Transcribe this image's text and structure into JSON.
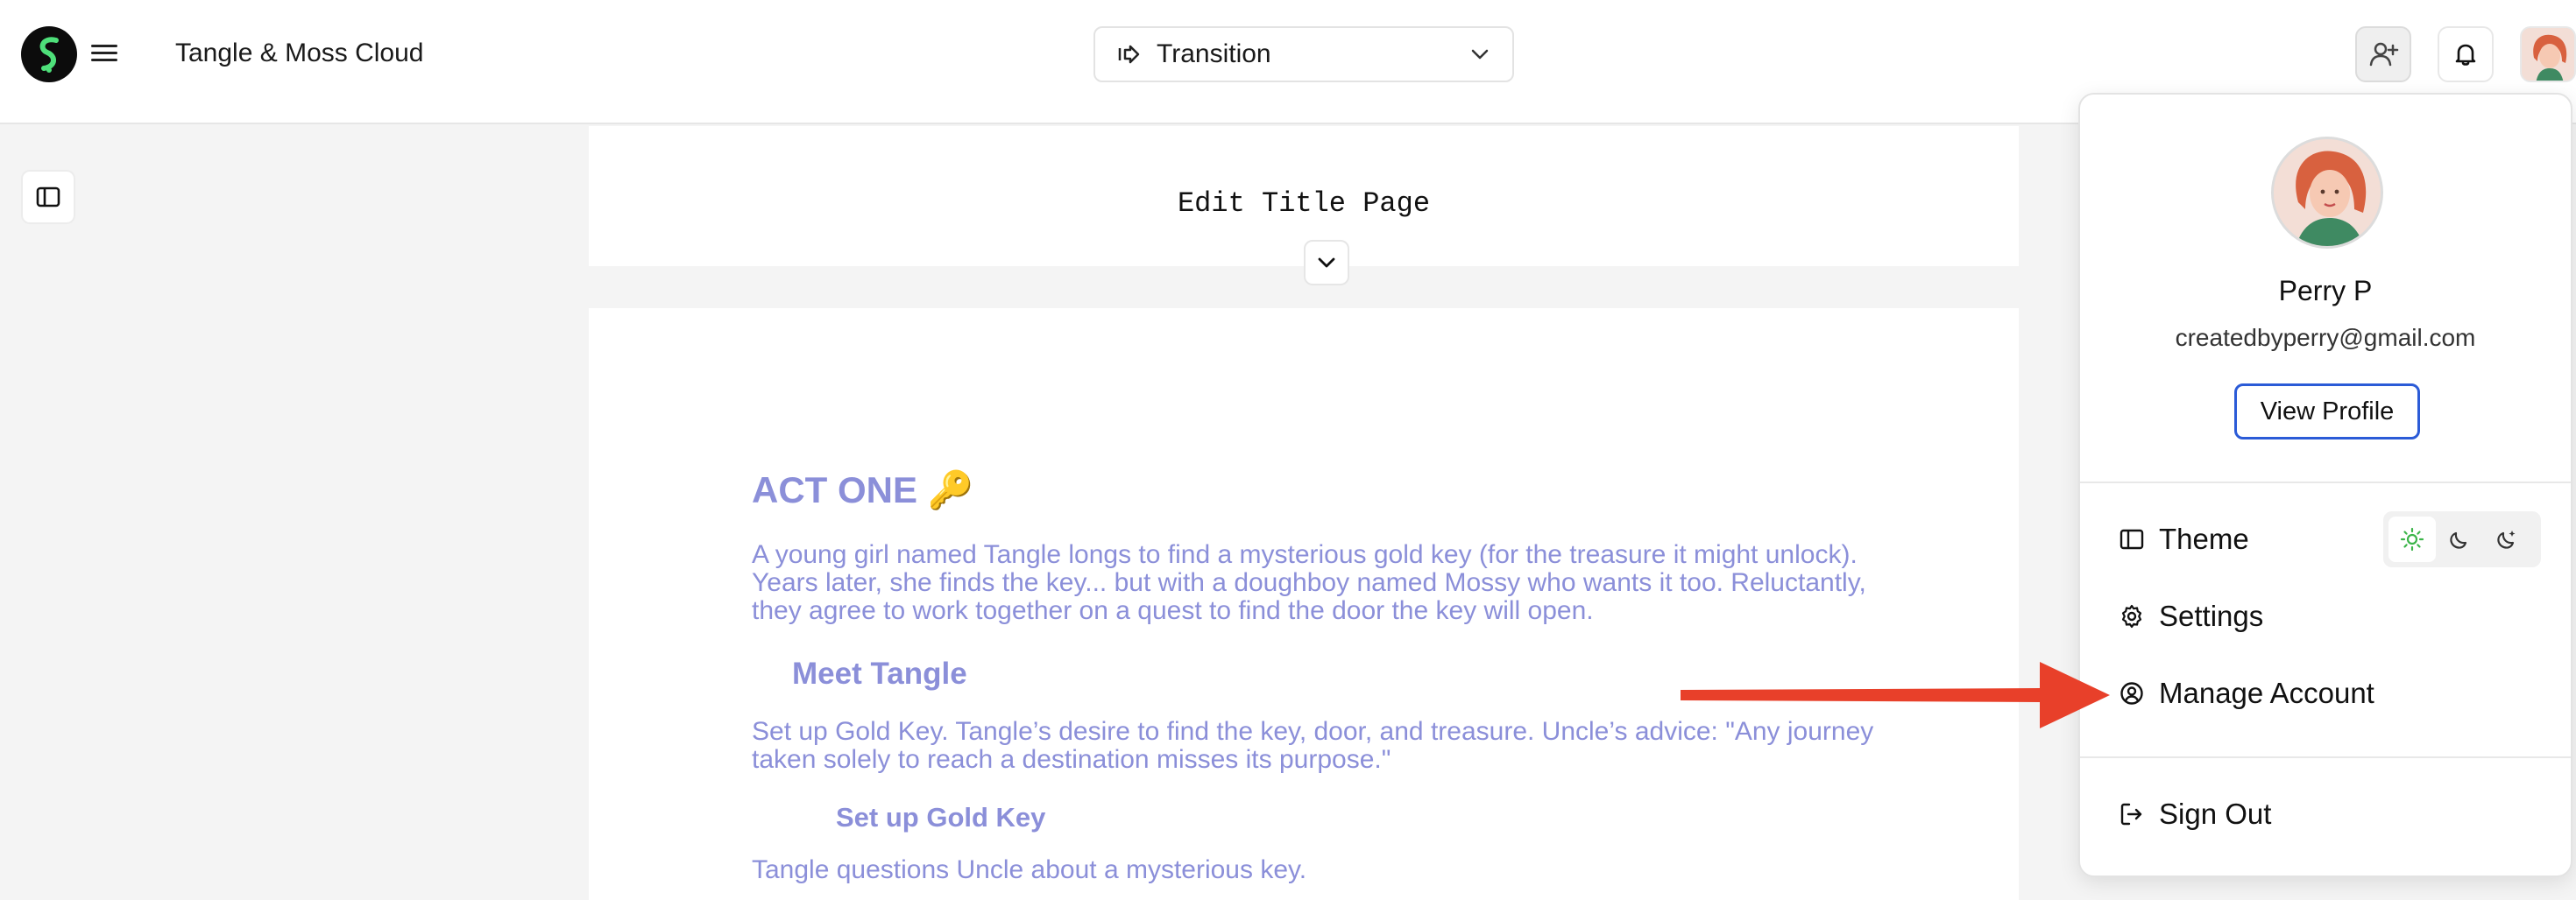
{
  "header": {
    "app_title": "Tangle & Moss Cloud",
    "element_selector": {
      "value": "Transition"
    }
  },
  "title_page": {
    "edit_label": "Edit Title Page"
  },
  "script": {
    "act": {
      "heading": "ACT ONE 🔑",
      "description": "A young girl named Tangle longs to find a mysterious gold key (for the treasure it might unlock). Years later, she finds the key... but with a doughboy named Mossy who wants it too. Reluctantly, they agree to work together on a quest to find the door the key will open."
    },
    "sequence": {
      "heading": "Meet Tangle",
      "description": "Set up Gold Key. Tangle’s desire to find the key, door, and treasure. Uncle’s advice: \"Any journey taken solely to reach a destination misses its purpose.\""
    },
    "scene": {
      "heading": "Set up Gold Key",
      "description": "Tangle questions Uncle about a mysterious key."
    }
  },
  "profile_menu": {
    "name": "Perry P",
    "email": "createdbyperry@gmail.com",
    "view_profile_label": "View Profile",
    "theme_label": "Theme",
    "theme_options": [
      "light",
      "dark",
      "system"
    ],
    "theme_selected": "light",
    "settings_label": "Settings",
    "manage_account_label": "Manage Account",
    "sign_out_label": "Sign Out"
  },
  "icons": {
    "logo": "logo-icon",
    "menu": "hamburger-icon",
    "transition": "transition-icon",
    "add_user": "add-user-icon",
    "bell": "bell-icon",
    "sidebar": "sidebar-toggle-icon",
    "expand": "chevron-down-icon"
  },
  "colors": {
    "script_text": "#8b8fd9",
    "view_profile_border": "#2b5bd7",
    "annotation_arrow": "#e8402a",
    "logo_accent": "#4ee07a"
  }
}
